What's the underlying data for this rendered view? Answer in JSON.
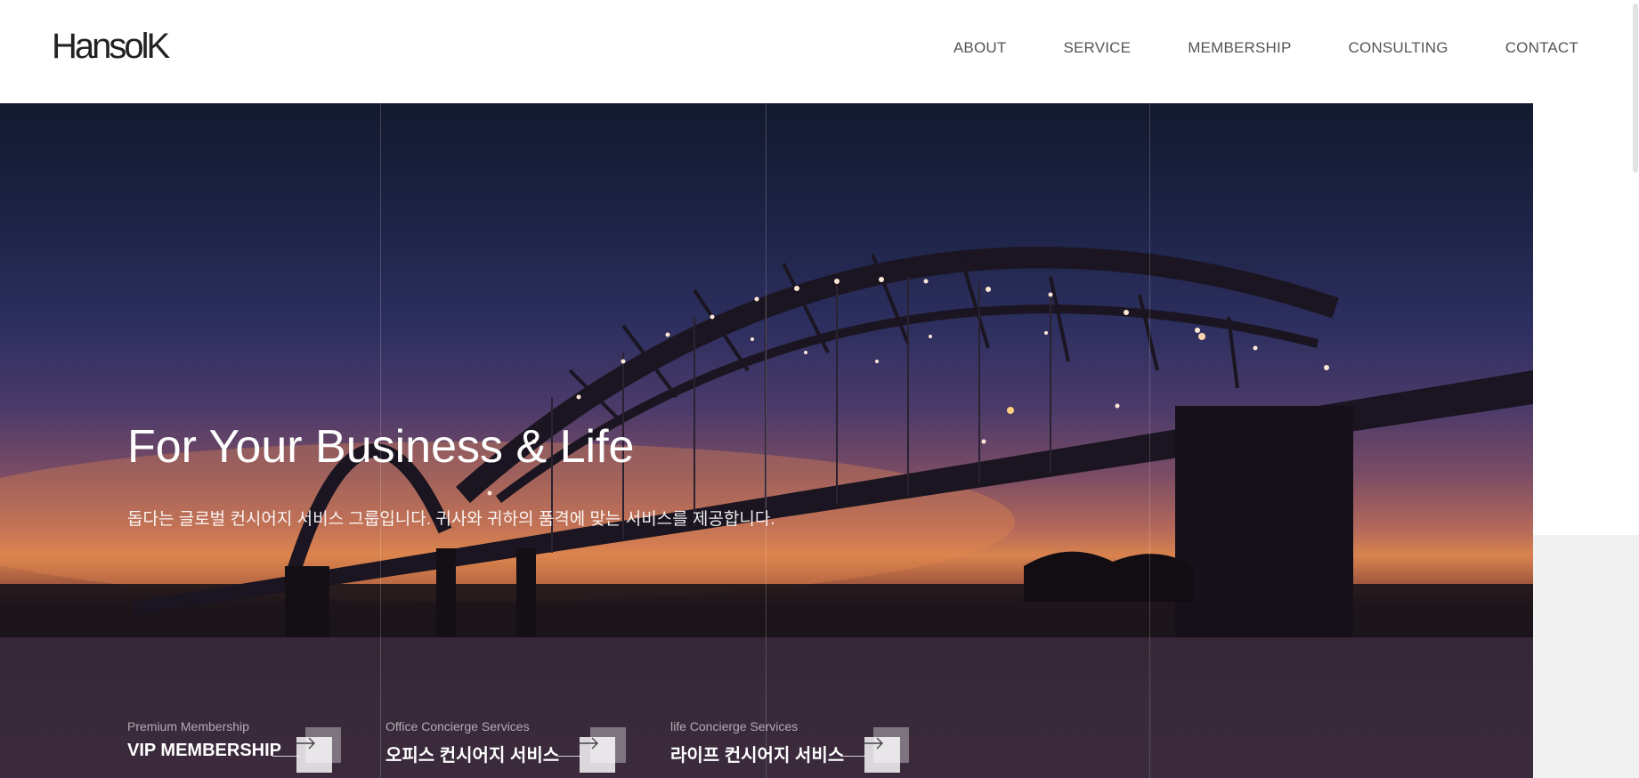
{
  "header": {
    "logo": "HansolK",
    "nav": [
      "ABOUT",
      "SERVICE",
      "MEMBERSHIP",
      "CONSULTING",
      "CONTACT"
    ]
  },
  "hero": {
    "title": "For Your Business & Life",
    "subtitle": "돕다는 글로벌 컨시어지 서비스 그룹입니다. 귀사와 귀하의 품격에 맞는 서비스를 제공합니다."
  },
  "cards": [
    {
      "small": "Premium Membership",
      "big": "VIP MEMBERSHIP"
    },
    {
      "small": "Office Concierge Services",
      "big": "오피스 컨시어지 서비스"
    },
    {
      "small": "life Concierge Services",
      "big": "라이프 컨시어지 서비스"
    }
  ],
  "icons": [
    "arrow-right-icon"
  ]
}
